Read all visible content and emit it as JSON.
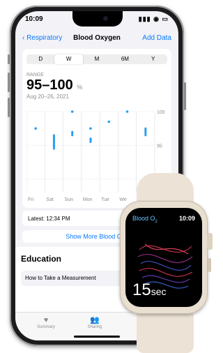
{
  "status": {
    "time": "10:09",
    "icons": "▮▮▮ ◉ ▭"
  },
  "nav": {
    "back": "‹ Respiratory",
    "title": "Blood Oxygen",
    "add": "Add Data"
  },
  "segments": [
    "D",
    "W",
    "M",
    "6M",
    "Y"
  ],
  "selected_segment": "W",
  "summary": {
    "label": "RANGE",
    "value": "95–100",
    "unit": "%",
    "date": "Aug 20–26, 2021"
  },
  "chart_data": {
    "type": "scatter",
    "categories": [
      "Fri",
      "Sat",
      "Sun",
      "Mon",
      "Tue",
      "We"
    ],
    "ylim": [
      88,
      100
    ],
    "yticks": [
      100,
      95,
      90
    ],
    "series": [
      {
        "points": [
          {
            "x": "Fri",
            "y": 97.5
          },
          {
            "x": "Sat",
            "y": 94.5,
            "y2": 96.5
          },
          {
            "x": "Sun",
            "y": 100
          },
          {
            "x": "Sun",
            "y": 96.5,
            "y2": 97
          },
          {
            "x": "Mon",
            "y": 97.5
          },
          {
            "x": "Mon",
            "y": 95.5,
            "y2": 96
          },
          {
            "x": "Tue",
            "y": 98.5
          },
          {
            "x": "We",
            "y": 100
          },
          {
            "x": "We+",
            "y": 96.5,
            "y2": 97.5
          }
        ]
      }
    ],
    "color": "#2a9df4",
    "grid": true
  },
  "latest": {
    "label": "Latest: 12:34 PM"
  },
  "show_more": {
    "label": "Show More Blood Oxy"
  },
  "education": {
    "heading": "Education",
    "item": "How to Take a Measurement"
  },
  "tabs": [
    {
      "label": "Summary",
      "icon": "heart-icon"
    },
    {
      "label": "Sharing",
      "icon": "people-icon"
    }
  ],
  "watch": {
    "title": "Blood O",
    "title_sub": "2",
    "time": "10:09",
    "count": "15",
    "count_unit": "sec"
  },
  "colors": {
    "accent": "#0a7aff",
    "chart": "#2a9df4",
    "watch_title": "#67c5ff"
  }
}
